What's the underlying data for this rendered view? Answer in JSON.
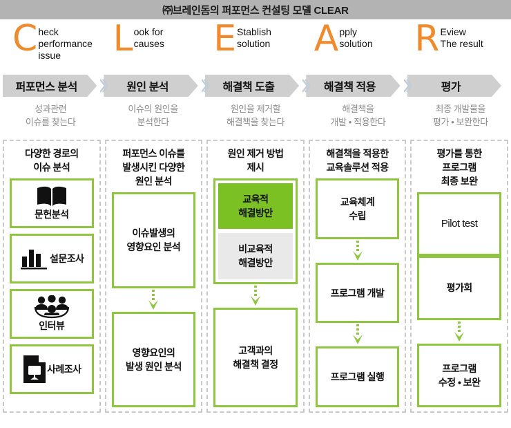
{
  "header": {
    "title": "㈜브레인돔의 퍼포먼스 컨설팅 모델 CLEAR",
    "bar_color": "#b3b3b3"
  },
  "accent": {
    "orange": "#ef8b2c",
    "green_border": "#8ec640",
    "green_fill": "#7cc123",
    "grey_fill": "#e9e9e9",
    "chevron_fill": "#cfcfcf",
    "chevron_arrow": "#c3cdd8",
    "desc_text": "#8c8c8c"
  },
  "acronym": [
    {
      "letter": "C",
      "lines": [
        "heck",
        "performance",
        "issue"
      ]
    },
    {
      "letter": "L",
      "lines": [
        "ook for",
        "causes"
      ]
    },
    {
      "letter": "E",
      "lines": [
        "Stablish",
        "solution"
      ]
    },
    {
      "letter": "A",
      "lines": [
        "pply",
        "solution"
      ]
    },
    {
      "letter": "R",
      "lines": [
        "Eview",
        "The result"
      ]
    }
  ],
  "steps": [
    {
      "label": "퍼포먼스 분석",
      "desc": [
        "성과관련",
        "이슈를 찾는다"
      ]
    },
    {
      "label": "원인 분석",
      "desc": [
        "이슈의 원인을",
        "분석한다"
      ]
    },
    {
      "label": "해결책 도출",
      "desc": [
        "원인을 제거할",
        "해결책을 찾는다"
      ]
    },
    {
      "label": "해결책 적용",
      "desc": [
        "해결책을",
        "개발 • 적용한다"
      ]
    },
    {
      "label": "평가",
      "desc": [
        "최종 개발물을",
        "평가 • 보완한다"
      ]
    }
  ],
  "columns": [
    {
      "title": [
        "다양한 경로의",
        "이슈 분석"
      ],
      "kind": "icon-cards",
      "items": [
        {
          "icon": "open-book-icon",
          "label": "문헌분석",
          "layout": "stacked"
        },
        {
          "icon": "bar-chart-icon",
          "label": "설문조사",
          "layout": "inline"
        },
        {
          "icon": "people-group-icon",
          "label": "인터뷰",
          "layout": "stacked"
        },
        {
          "icon": "case-document-icon",
          "label": "사례조사",
          "layout": "inline"
        }
      ]
    },
    {
      "title": [
        "퍼포먼스 이슈를",
        "발생시킨 다양한",
        "원인 분석"
      ],
      "kind": "flow",
      "items": [
        {
          "type": "card",
          "lines": [
            "이슈발생의",
            "영향요인 분석"
          ]
        },
        {
          "type": "arrow"
        },
        {
          "type": "card",
          "lines": [
            "영향요인의",
            "발생 원인 분석"
          ]
        }
      ]
    },
    {
      "title": [
        "원인 제거 방법",
        "제시"
      ],
      "kind": "flow",
      "items": [
        {
          "type": "stack",
          "parts": [
            {
              "fill": "green",
              "lines": [
                "교육적",
                "해결방안"
              ]
            },
            {
              "fill": "grey",
              "lines": [
                "비교육적",
                "해결방안"
              ]
            }
          ]
        },
        {
          "type": "arrow"
        },
        {
          "type": "card",
          "lines": [
            "고객과의",
            "해결책 결정"
          ]
        }
      ]
    },
    {
      "title": [
        "해결책을 적용한",
        "교육솔루션 적용"
      ],
      "kind": "flow",
      "items": [
        {
          "type": "card",
          "lines": [
            "교육체계",
            "수립"
          ]
        },
        {
          "type": "arrow"
        },
        {
          "type": "card",
          "lines": [
            "프로그램 개발"
          ]
        },
        {
          "type": "arrow"
        },
        {
          "type": "card",
          "lines": [
            "프로그램 실행"
          ]
        }
      ]
    },
    {
      "title": [
        "평가를 통한",
        "프로그램",
        "최종 보완"
      ],
      "kind": "flow",
      "items": [
        {
          "type": "card",
          "lines": [
            "Pilot test"
          ],
          "latin": true
        },
        {
          "type": "card",
          "lines": [
            "평가회"
          ]
        },
        {
          "type": "arrow"
        },
        {
          "type": "card",
          "lines": [
            "프로그램",
            "수정 • 보완"
          ]
        }
      ]
    }
  ]
}
